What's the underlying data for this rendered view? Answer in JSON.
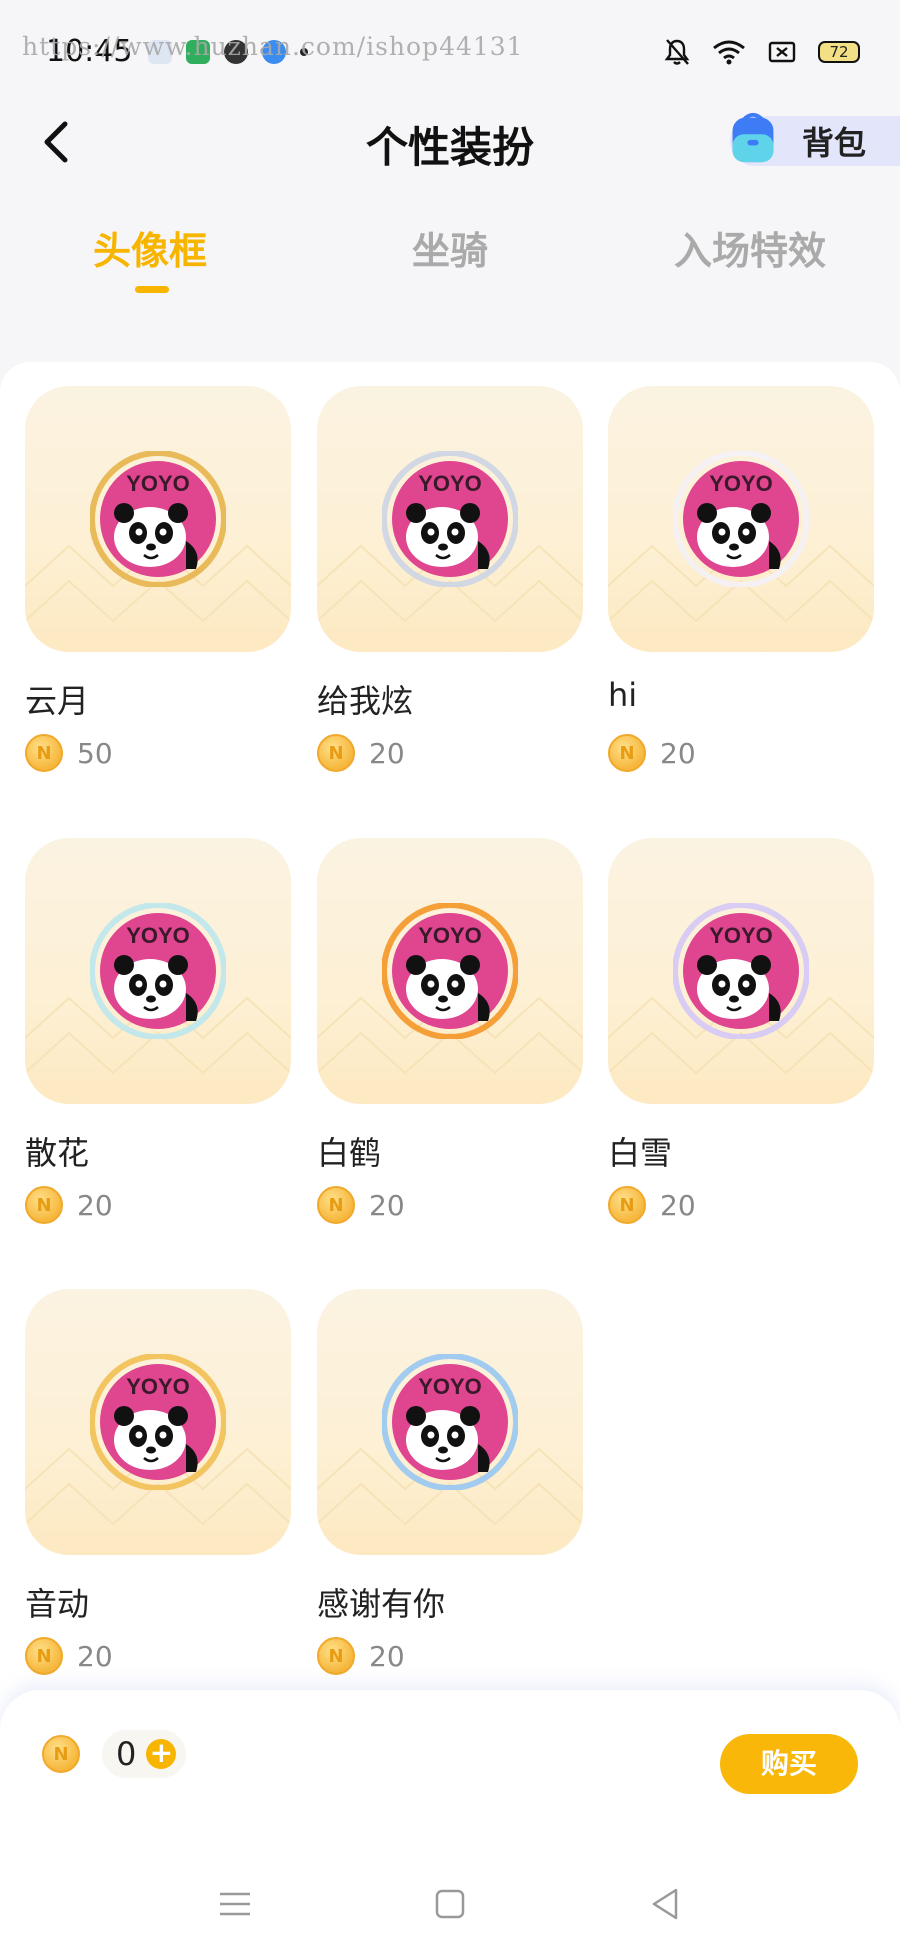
{
  "status_bar": {
    "time": "10:45",
    "watermark": "https://www.huzhan.com/ishop44131",
    "battery": "72"
  },
  "header": {
    "title": "个性装扮",
    "backpack_label": "背包"
  },
  "tabs": [
    {
      "label": "头像框",
      "active": true
    },
    {
      "label": "坐骑",
      "active": false
    },
    {
      "label": "入场特效",
      "active": false
    }
  ],
  "items": [
    {
      "name": "云月",
      "price": "50",
      "frame_color": "#e7b652"
    },
    {
      "name": "给我炫",
      "price": "20",
      "frame_color": "#cfd6e4"
    },
    {
      "name": "hi",
      "price": "20",
      "frame_color": "#f4f0f4"
    },
    {
      "name": "散花",
      "price": "20",
      "frame_color": "#bfe7ec"
    },
    {
      "name": "白鹤",
      "price": "20",
      "frame_color": "#f39a2e"
    },
    {
      "name": "白雪",
      "price": "20",
      "frame_color": "#d7c9f5"
    },
    {
      "name": "音动",
      "price": "20",
      "frame_color": "#f2c25a"
    },
    {
      "name": "感谢有你",
      "price": "20",
      "frame_color": "#9cc8f0"
    }
  ],
  "avatar_text": "YOYO",
  "bottom": {
    "balance": "0",
    "buy_label": "购买"
  },
  "colors": {
    "accent": "#f7b500",
    "tab_inactive": "#aaaaaa",
    "avatar_bg": "#e0458f"
  }
}
